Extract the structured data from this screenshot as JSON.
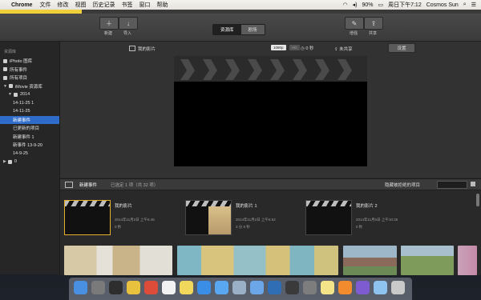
{
  "menubar": {
    "apple_glyph": "",
    "app_name": "Chrome",
    "items": [
      "文件",
      "修改",
      "视图",
      "历史记录",
      "书签",
      "窗口",
      "帮助"
    ],
    "battery": "90%",
    "clock": "周日下午7:12",
    "user": "Cosmos Sun",
    "icons": [
      "wifi-icon",
      "volume-icon",
      "battery-icon",
      "search-icon",
      "list-icon"
    ]
  },
  "progress": 0.17,
  "toolbar": {
    "new_label": "新建",
    "import_label": "导入",
    "tabs": [
      "资源库",
      "剧场"
    ],
    "active_tab": "资源库",
    "enhance_label": "增强",
    "share_label": "共享"
  },
  "sidebar": {
    "header": "资源库",
    "items": [
      {
        "label": "iPhoto 图库",
        "indent": 0,
        "icon": "photo-icon",
        "selected": false
      },
      {
        "label": "所有事件",
        "indent": 0,
        "icon": "events-icon",
        "selected": false
      },
      {
        "label": "所有项目",
        "indent": 0,
        "icon": "projects-icon",
        "selected": false
      },
      {
        "label": "iMovie 资源库",
        "indent": 0,
        "icon": "library-icon",
        "selected": false,
        "triangle": "▼"
      },
      {
        "label": "2014",
        "indent": 1,
        "icon": "folder-icon",
        "selected": false,
        "triangle": "▼"
      },
      {
        "label": "14-11-25 1",
        "indent": 2,
        "icon": "",
        "selected": false
      },
      {
        "label": "14-11-25",
        "indent": 2,
        "icon": "",
        "selected": false
      },
      {
        "label": "新建事件",
        "indent": 2,
        "icon": "",
        "selected": true
      },
      {
        "label": "已更新的项目",
        "indent": 2,
        "icon": "",
        "selected": false
      },
      {
        "label": "新建事件 1",
        "indent": 2,
        "icon": "",
        "selected": false
      },
      {
        "label": "新事件 13-9-20",
        "indent": 2,
        "icon": "",
        "selected": false
      },
      {
        "label": "14-9-25",
        "indent": 2,
        "icon": "",
        "selected": false
      },
      {
        "label": "0",
        "indent": 0,
        "icon": "folder-icon",
        "selected": false,
        "triangle": "▶"
      }
    ]
  },
  "viewer": {
    "title": "我的影片",
    "res_badge": "1080p",
    "res_badge2": "HD",
    "duration": "0 秒",
    "status": "未共享",
    "settings": "设置"
  },
  "browser": {
    "title": "新建事件",
    "subtitle": "已选定 1 项（共 32 项）",
    "hide_label": "隐藏被拒绝的项目",
    "projects": [
      {
        "name": "我的影片",
        "date": "2014年11月2日 上午6:46",
        "duration": "0 秒",
        "selected": true
      },
      {
        "name": "我的影片 1",
        "date": "2014年11月2日 上午6:52",
        "duration": "3 分 8 秒",
        "selected": false
      },
      {
        "name": "我的影片 2",
        "date": "2014年11月5日 上午10:26",
        "duration": "0 秒",
        "selected": false
      }
    ]
  },
  "colors": {
    "selection": "#2f6bc8",
    "accent_yellow": "#e5b12c"
  },
  "dock": {
    "icons": [
      "finder-icon",
      "launchpad-icon",
      "mission-control-icon",
      "photos-icon",
      "chrome-icon",
      "calendar-icon",
      "notes-icon",
      "app-store-icon",
      "safari-icon",
      "preview-icon",
      "mail-icon",
      "keynote-icon",
      "activity-icon",
      "system-preferences-icon",
      "stickies-icon",
      "pages-icon",
      "imovie-icon",
      "messages-icon",
      "trash-icon"
    ]
  }
}
